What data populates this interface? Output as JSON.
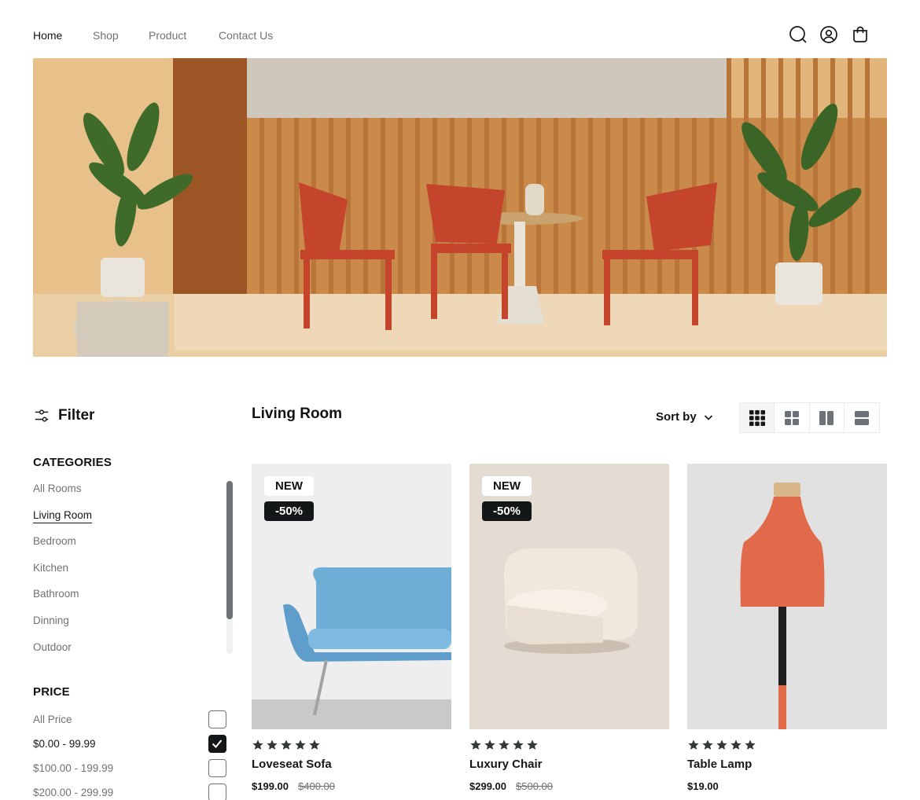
{
  "nav": {
    "links": [
      "Home",
      "Shop",
      "Product",
      "Contact Us"
    ],
    "active": "Home",
    "icons": [
      "search-icon",
      "user-icon",
      "bag-icon"
    ]
  },
  "hero": {
    "image": "living-room-hero-with-red-chairs-round-table-and-plants"
  },
  "sidebar": {
    "filter_title": "Filter",
    "categories_title": "CATEGORIES",
    "categories": [
      "All Rooms",
      "Living Room",
      "Bedroom",
      "Kitchen",
      "Bathroom",
      "Dinning",
      "Outdoor"
    ],
    "active_category": "Living Room",
    "price_title": "PRICE",
    "prices": [
      {
        "label": "All Price",
        "checked": false
      },
      {
        "label": "$0.00 - 99.99",
        "checked": true
      },
      {
        "label": "$100.00 - 199.99",
        "checked": false
      },
      {
        "label": "$200.00 - 299.99",
        "checked": false
      }
    ]
  },
  "main": {
    "title": "Living Room",
    "sort_label": "Sort by",
    "view_modes": [
      "grid-3",
      "grid-2",
      "columns-2",
      "rows-2"
    ],
    "active_view": "grid-3"
  },
  "products": [
    {
      "name": "Loveseat Sofa",
      "price": "$199.00",
      "old_price": "$400.00",
      "badge_new": "NEW",
      "badge_discount": "-50%",
      "rating": 5,
      "image": "blue-loveseat-sofa"
    },
    {
      "name": "Luxury Chair",
      "price": "$299.00",
      "old_price": "$500.00",
      "badge_new": "NEW",
      "badge_discount": "-50%",
      "rating": 5,
      "image": "cream-boucle-chair"
    },
    {
      "name": "Table Lamp",
      "price": "$19.00",
      "old_price": "",
      "badge_new": "",
      "badge_discount": "",
      "rating": 5,
      "image": "orange-table-lamp"
    }
  ],
  "colors": {
    "text": "#141718",
    "muted": "#6c7275",
    "accent_dark": "#141718",
    "star": "#343839"
  }
}
